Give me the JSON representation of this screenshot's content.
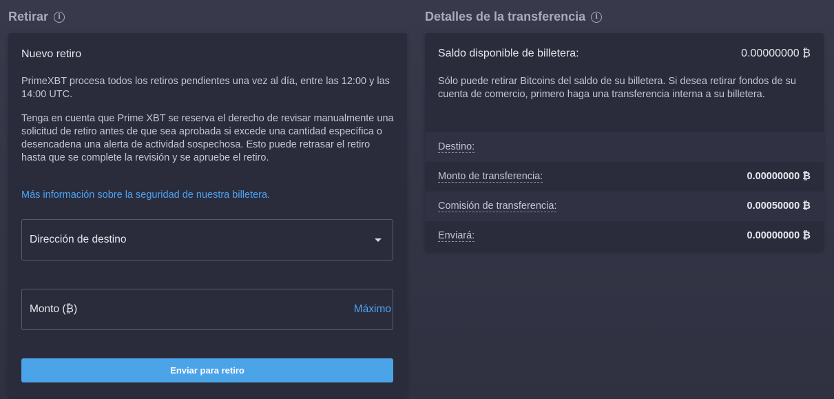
{
  "withdraw": {
    "title": "Retirar",
    "heading": "Nuevo retiro",
    "paragraph1": "PrimeXBT procesa todos los retiros pendientes una vez al día, entre las 12:00 y las 14:00 UTC.",
    "paragraph2": "Tenga en cuenta que Prime XBT se reserva el derecho de revisar manualmente una solicitud de retiro antes de que sea aprobada si excede una cantidad específica o desencadena una alerta de actividad sospechosa. Esto puede retrasar el retiro hasta que se complete la revisión y se apruebe el retiro.",
    "security_link": "Más información sobre la seguridad de nuestra billetera.",
    "destination_label": "Dirección de destino",
    "amount_label": "Monto (₿)",
    "max_label": "Máximo",
    "submit_label": "Enviar para retiro"
  },
  "transfer": {
    "title": "Detalles de la transferencia",
    "balance_label": "Saldo disponible de billetera:",
    "balance_value": "0.00000000 ₿",
    "note": "Sólo puede retirar Bitcoins del saldo de su billetera. Si desea retirar fondos de su cuenta de comercio, primero haga una transferencia interna a su billetera.",
    "rows": [
      {
        "label": "Destino:",
        "value": ""
      },
      {
        "label": "Monto de transferencia:",
        "value": "0.00000000 ₿"
      },
      {
        "label": "Comisión de transferencia:",
        "value": "0.00050000 ₿"
      },
      {
        "label": "Enviará:",
        "value": "0.00000000 ₿"
      }
    ]
  },
  "colors": {
    "accent": "#4ba3e8",
    "link": "#4ba3f5",
    "panel": "#2b2c3b"
  },
  "icons": {
    "info": "info-icon",
    "caret": "chevron-down-icon"
  }
}
